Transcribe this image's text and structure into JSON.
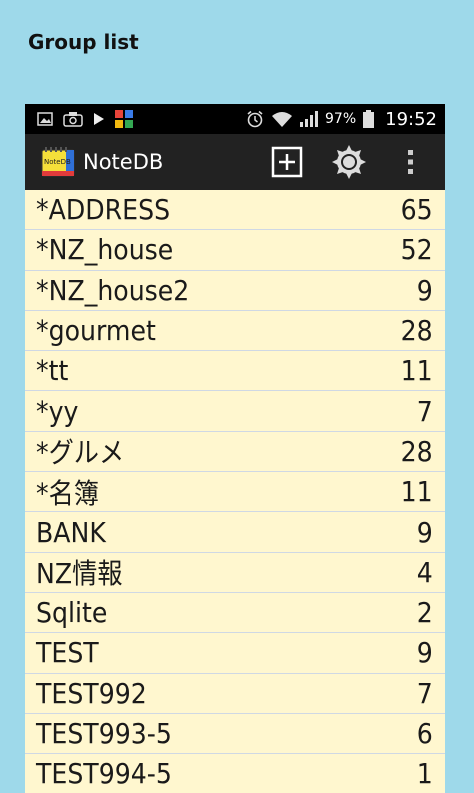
{
  "page": {
    "heading": "Group list"
  },
  "status_bar": {
    "battery_percent": "97%",
    "time": "19:52",
    "icons": [
      "image-icon",
      "camera-icon",
      "play-store-icon",
      "app-grid-icon",
      "alarm-icon",
      "wifi-icon",
      "signal-icon",
      "battery-icon"
    ]
  },
  "app": {
    "title": "NoteDB",
    "logo_text": "NoteDB",
    "actions": [
      "add-icon",
      "brightness-icon",
      "overflow-menu-icon"
    ]
  },
  "groups": [
    {
      "name": "*ADDRESS",
      "count": "65"
    },
    {
      "name": "*NZ_house",
      "count": "52"
    },
    {
      "name": "*NZ_house2",
      "count": "9"
    },
    {
      "name": "*gourmet",
      "count": "28"
    },
    {
      "name": "*tt",
      "count": "11"
    },
    {
      "name": "*yy",
      "count": "7"
    },
    {
      "name": "*グルメ",
      "count": "28"
    },
    {
      "name": "*名簿",
      "count": "11"
    },
    {
      "name": "BANK",
      "count": "9"
    },
    {
      "name": "NZ情報",
      "count": "4"
    },
    {
      "name": "Sqlite",
      "count": "2"
    },
    {
      "name": "TEST",
      "count": "9"
    },
    {
      "name": "TEST992",
      "count": "7"
    },
    {
      "name": "TEST993-5",
      "count": "6"
    },
    {
      "name": "TEST994-5",
      "count": "1"
    }
  ],
  "colors": {
    "background": "#9ed9ea",
    "row": "#fff7cf",
    "action_bar": "#222222",
    "status_bar": "#000000"
  }
}
